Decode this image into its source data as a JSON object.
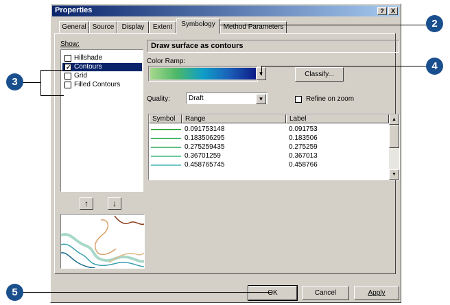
{
  "window": {
    "title": "Properties",
    "help_glyph": "?",
    "close_glyph": "X"
  },
  "tabs": [
    {
      "label": "General"
    },
    {
      "label": "Source"
    },
    {
      "label": "Display"
    },
    {
      "label": "Extent"
    },
    {
      "label": "Symbology"
    },
    {
      "label": "Method Parameters"
    }
  ],
  "show": {
    "label": "Show:",
    "items": [
      {
        "label": "Hillshade",
        "checked": false,
        "selected": false
      },
      {
        "label": "Contours",
        "checked": true,
        "selected": true
      },
      {
        "label": "Grid",
        "checked": false,
        "selected": false
      },
      {
        "label": "Filled Contours",
        "checked": false,
        "selected": false
      }
    ],
    "up_glyph": "↑",
    "down_glyph": "↓"
  },
  "symbology": {
    "heading": "Draw surface as contours",
    "color_ramp_label": "Color Ramp:",
    "classify_label": "Classify...",
    "quality_label": "Quality:",
    "quality_value": "Draft",
    "refine_label": "Refine on zoom",
    "refine_checked": false
  },
  "table": {
    "headers": {
      "symbol": "Symbol",
      "range": "Range",
      "label": "Label"
    },
    "rows": [
      {
        "range": "0.091753148",
        "label": "0.091753",
        "color": "#3aa84a"
      },
      {
        "range": "0.183506295",
        "label": "0.183506",
        "color": "#48b86a"
      },
      {
        "range": "0.275259435",
        "label": "0.275259",
        "color": "#62c084"
      },
      {
        "range": "0.36701259",
        "label": "0.367013",
        "color": "#6cc8a0"
      },
      {
        "range": "0.458765745",
        "label": "0.458766",
        "color": "#70c6c8"
      }
    ]
  },
  "buttons": {
    "ok": "OK",
    "cancel": "Cancel",
    "apply": "Apply"
  },
  "callouts": {
    "c2": "2",
    "c3": "3",
    "c4": "4",
    "c5": "5"
  },
  "colors": {
    "callout": "#1a4f8e",
    "title_start": "#0a246a",
    "title_end": "#a6caf0"
  }
}
